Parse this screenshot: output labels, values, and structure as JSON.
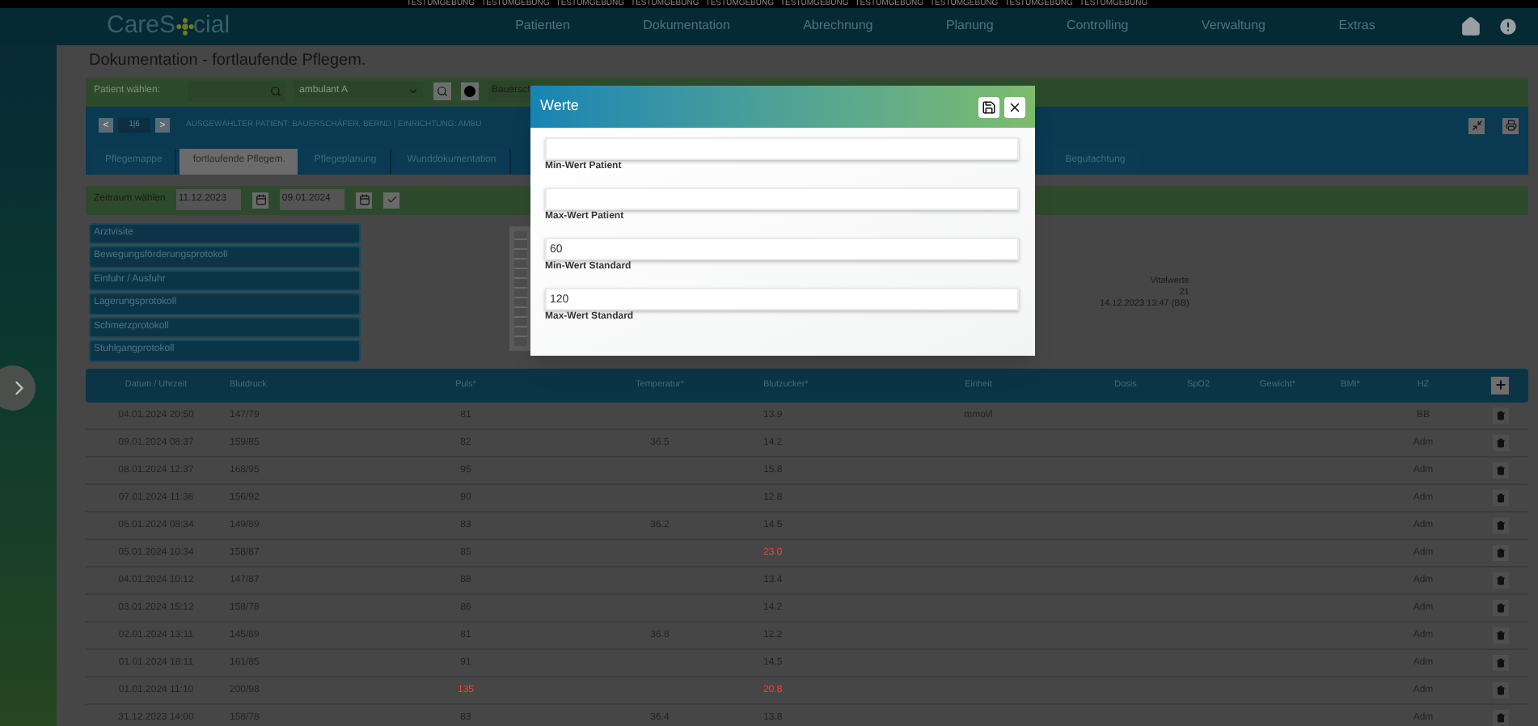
{
  "environment_banner": [
    "TESTUMGEBUNG",
    "TESTUMGEBUNG",
    "TESTUMGEBUNG",
    "TESTUMGEBUNG",
    "TESTUMGEBUNG",
    "TESTUMGEBUNG",
    "TESTUMGEBUNG",
    "TESTUMGEBUNG",
    "TESTUMGEBUNG",
    "TESTUMGEBUNG"
  ],
  "logo": {
    "before": "CareS",
    "after": "cial"
  },
  "nav": [
    "Patienten",
    "Dokumentation",
    "Abrechnung",
    "Planung",
    "Controlling",
    "Verwaltung",
    "Extras"
  ],
  "page_title": "Dokumentation - fortlaufende Pflegem.",
  "patient_toolbar": {
    "label": "Patient wählen:",
    "facility": "ambulant A",
    "patient_field": "Bauersch"
  },
  "pager": {
    "previous": "<",
    "position": "1|6",
    "next": ">",
    "patient_info": "AUSGEWÄHLTER PATIENT: BAUERSCHÄFER, BERND | EINRICHTUNG: AMBU"
  },
  "tabs": [
    {
      "label": "Pflegemappe",
      "selected": false
    },
    {
      "label": "fortlaufende Pflegem.",
      "selected": true
    },
    {
      "label": "Pflegeplanung",
      "selected": false
    },
    {
      "label": "Wunddokumentation",
      "selected": false
    }
  ],
  "right_tab": {
    "label": "Begutachtung",
    "selected": false
  },
  "period": {
    "label": "Zeitraum wählen",
    "from": "11.12.2023",
    "to": "09.01.2024"
  },
  "protocols": [
    "Arztvisite",
    "Bewegungsförderungsprotokoll",
    "Einfuhr / Ausfuhr",
    "Lagerungsprotokoll",
    "Schmerzprotokoll",
    "Stuhlgangprotokoll"
  ],
  "vitals_summary": [
    "Vitalwerte",
    "21",
    "14.12.2023 13:47 (BB)"
  ],
  "table": {
    "columns": [
      "Datum / Uhrzeit",
      "Blutdruck",
      "Puls*",
      "Temperatur*",
      "Blutzucker*",
      "Einheit",
      "Dosis",
      "SpO2",
      "Gewicht*",
      "BMI*",
      "HZ"
    ],
    "rows": [
      {
        "datetime": "04.01.2024 20:50",
        "blood_pressure": "147/79",
        "pulse": "81",
        "blood_sugar": "13.9",
        "unit": "mmol/l",
        "hz": "BB",
        "pulse_alert": false,
        "blood_sugar_alert": false
      },
      {
        "datetime": "09.01.2024 08:37",
        "blood_pressure": "159/85",
        "pulse": "82",
        "temperature": "36.5",
        "blood_sugar": "14.2",
        "hz": "Adm",
        "pulse_alert": false,
        "blood_sugar_alert": false
      },
      {
        "datetime": "08.01.2024 12:37",
        "blood_pressure": "168/95",
        "pulse": "95",
        "blood_sugar": "15.8",
        "hz": "Adm",
        "pulse_alert": false,
        "blood_sugar_alert": false
      },
      {
        "datetime": "07.01.2024 11:36",
        "blood_pressure": "156/92",
        "pulse": "90",
        "blood_sugar": "12.8",
        "hz": "Adm",
        "pulse_alert": false,
        "blood_sugar_alert": false
      },
      {
        "datetime": "06.01.2024 08:34",
        "blood_pressure": "149/89",
        "pulse": "83",
        "temperature": "36.2",
        "blood_sugar": "14.5",
        "hz": "Adm",
        "pulse_alert": false,
        "blood_sugar_alert": false
      },
      {
        "datetime": "05.01.2024 10:34",
        "blood_pressure": "158/87",
        "pulse": "85",
        "blood_sugar": "23.0",
        "hz": "Adm",
        "pulse_alert": false,
        "blood_sugar_alert": true
      },
      {
        "datetime": "04.01.2024 10:12",
        "blood_pressure": "147/87",
        "pulse": "88",
        "blood_sugar": "13.4",
        "hz": "Adm",
        "pulse_alert": false,
        "blood_sugar_alert": false
      },
      {
        "datetime": "03.01.2024 15:12",
        "blood_pressure": "158/78",
        "pulse": "86",
        "blood_sugar": "14.2",
        "hz": "Adm",
        "pulse_alert": false,
        "blood_sugar_alert": false
      },
      {
        "datetime": "02.01.2024 13:11",
        "blood_pressure": "145/89",
        "pulse": "81",
        "temperature": "36.8",
        "blood_sugar": "12.2",
        "hz": "Adm",
        "pulse_alert": false,
        "blood_sugar_alert": false
      },
      {
        "datetime": "01.01.2024 18:11",
        "blood_pressure": "161/85",
        "pulse": "91",
        "blood_sugar": "14.5",
        "hz": "Adm",
        "pulse_alert": false,
        "blood_sugar_alert": false
      },
      {
        "datetime": "01.01.2024 11:10",
        "blood_pressure": "200/98",
        "pulse": "135",
        "blood_sugar": "20.8",
        "hz": "Adm",
        "pulse_alert": true,
        "blood_sugar_alert": true
      },
      {
        "datetime": "31.12.2023 14:00",
        "blood_pressure": "158/78",
        "pulse": "83",
        "temperature": "36.4",
        "blood_sugar": "13.8",
        "hz": "Adm",
        "pulse_alert": false,
        "blood_sugar_alert": false
      }
    ]
  },
  "dialog": {
    "title": "Werte",
    "fields": [
      {
        "label": "Min-Wert Patient"
      },
      {
        "label": "Max-Wert Patient"
      },
      {
        "label": "Min-Wert Standard",
        "value": "60"
      },
      {
        "label": "Max-Wert Standard",
        "value": "120"
      }
    ]
  }
}
